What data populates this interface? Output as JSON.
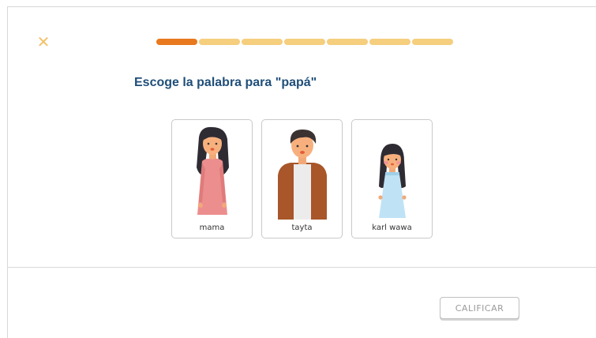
{
  "header": {
    "close_icon": "close-icon",
    "close_color": "#f2c26b",
    "progress": {
      "segments": 7,
      "completed": 1,
      "active_color": "#e8791e",
      "inactive_color": "#f5ce7e"
    }
  },
  "question": {
    "prompt": "Escoge la palabra para \"papá\""
  },
  "options": [
    {
      "label": "mama",
      "image": "woman-illustration"
    },
    {
      "label": "tayta",
      "image": "man-illustration"
    },
    {
      "label": "karl wawa",
      "image": "girl-illustration"
    }
  ],
  "footer": {
    "submit_label": "CALIFICAR"
  }
}
